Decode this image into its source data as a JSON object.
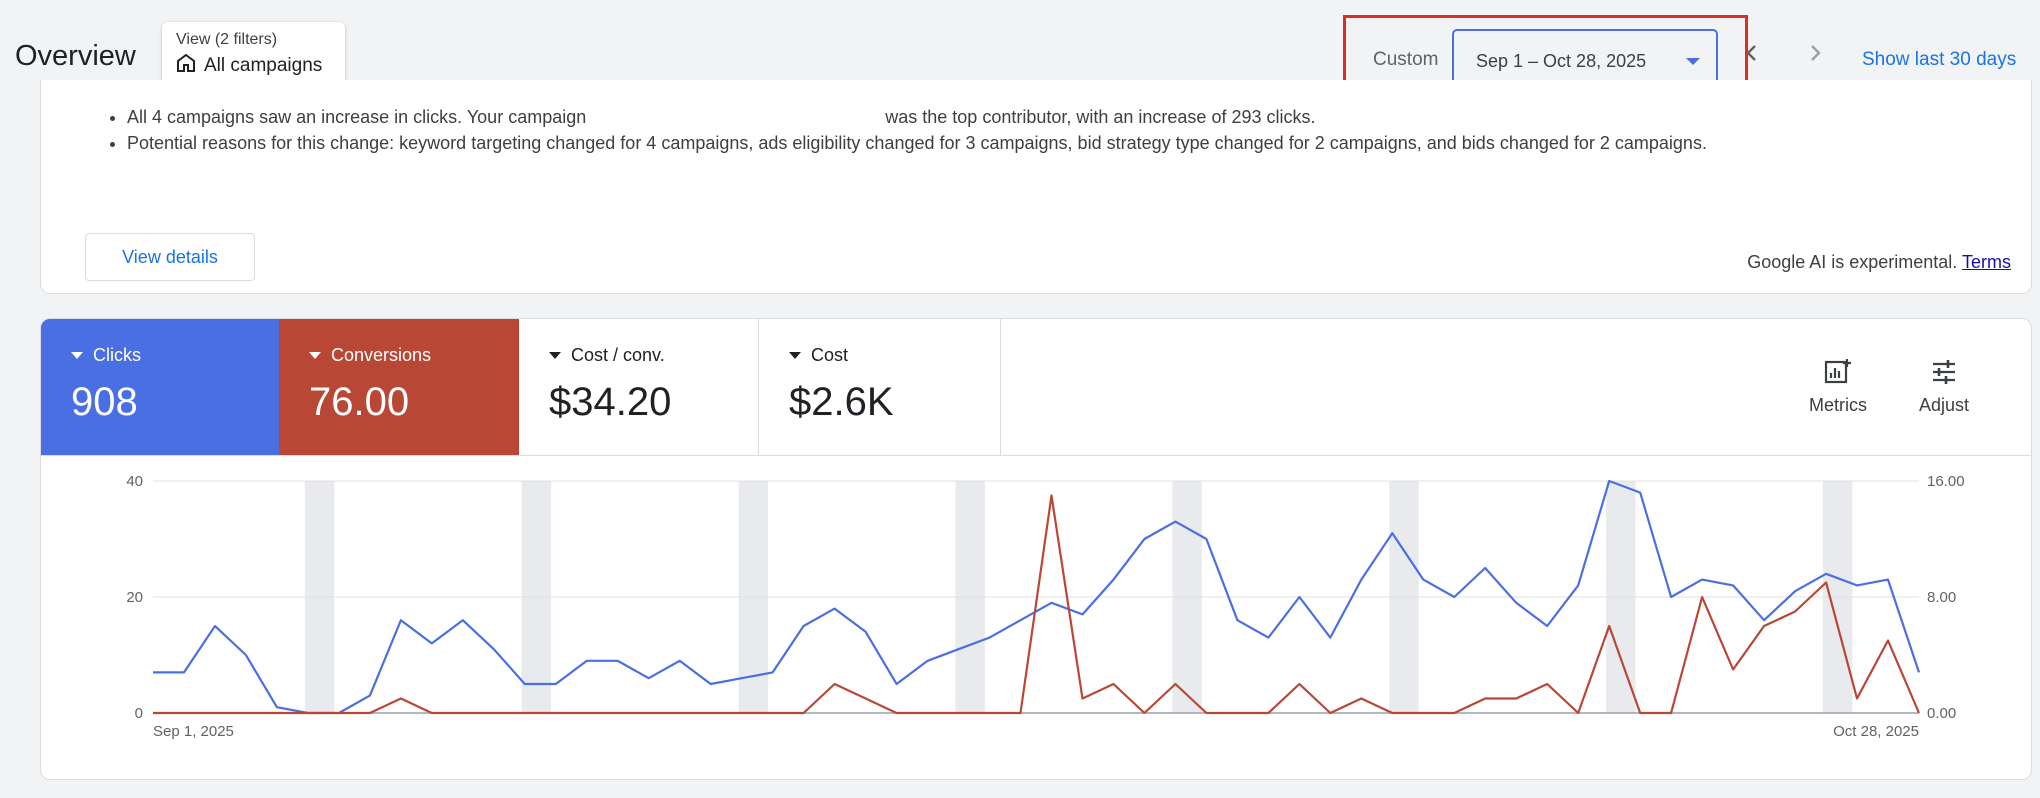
{
  "header": {
    "title": "Overview",
    "view_label": "View (2 filters)",
    "view_value": "All campaigns",
    "date_mode": "Custom",
    "date_range": "Sep 1 – Oct 28, 2025",
    "show_last": "Show last 30 days"
  },
  "insight": {
    "line1_pre": "All 4 campaigns saw an increase in clicks. Your campaign",
    "line1_post": "was the top contributor, with an increase of 293 clicks.",
    "line2": "Potential reasons for this change: keyword targeting changed for 4 campaigns, ads eligibility changed for 3 campaigns, bid strategy type changed for 2 campaigns, and bids changed for 2 campaigns.",
    "view_details": "View details",
    "ai_note": "Google AI is experimental.",
    "terms": "Terms"
  },
  "metrics": [
    {
      "name": "Clicks",
      "value": "908"
    },
    {
      "name": "Conversions",
      "value": "76.00"
    },
    {
      "name": "Cost / conv.",
      "value": "$34.20"
    },
    {
      "name": "Cost",
      "value": "$2.6K"
    }
  ],
  "tools": {
    "metrics": "Metrics",
    "adjust": "Adjust"
  },
  "colors": {
    "clicks": "#4a6fe3",
    "conversions": "#b84736",
    "weekend": "#e8eaed"
  },
  "chart_data": {
    "type": "line",
    "x_start_label": "Sep 1, 2025",
    "x_end_label": "Oct 28, 2025",
    "left_axis": {
      "ticks": [
        "0",
        "20",
        "40"
      ],
      "range": [
        0,
        40
      ]
    },
    "right_axis": {
      "ticks": [
        "0.00",
        "8.00",
        "16.00"
      ],
      "range": [
        0,
        16
      ]
    },
    "series": [
      {
        "name": "Clicks",
        "axis": "left",
        "values": [
          7,
          7,
          15,
          10,
          1,
          0,
          0,
          3,
          16,
          12,
          16,
          11,
          5,
          5,
          9,
          9,
          6,
          9,
          5,
          6,
          7,
          15,
          18,
          14,
          5,
          9,
          11,
          13,
          16,
          19,
          17,
          23,
          30,
          33,
          30,
          16,
          13,
          20,
          13,
          23,
          31,
          23,
          20,
          25,
          19,
          15,
          22,
          40,
          38,
          20,
          23,
          22,
          16,
          21,
          24,
          22,
          23,
          7
        ]
      },
      {
        "name": "Conversions",
        "axis": "right",
        "values": [
          0,
          0,
          0,
          0,
          0,
          0,
          0,
          0,
          1,
          0,
          0,
          0,
          0,
          0,
          0,
          0,
          0,
          0,
          0,
          0,
          0,
          0,
          2,
          1,
          0,
          0,
          0,
          0,
          0,
          15,
          1,
          2,
          0,
          2,
          0,
          0,
          0,
          2,
          0,
          1,
          0,
          0,
          0,
          1,
          1,
          2,
          0,
          6,
          0,
          0,
          8,
          3,
          6,
          7,
          9,
          1,
          5,
          0
        ]
      }
    ],
    "weekend_bands": [
      5,
      12,
      19,
      26,
      33,
      40,
      47,
      54
    ]
  }
}
